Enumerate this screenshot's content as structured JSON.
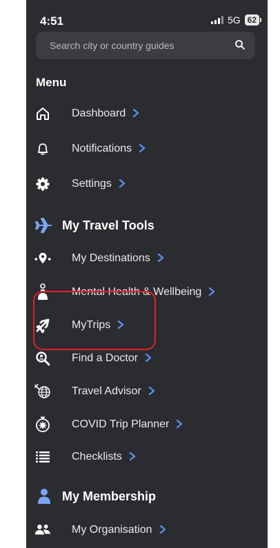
{
  "status": {
    "time": "4:51",
    "network": "5G",
    "battery": "62"
  },
  "search": {
    "placeholder": "Search city or country guides"
  },
  "menu": {
    "title": "Menu",
    "items": [
      {
        "label": "Dashboard",
        "icon": "home-icon"
      },
      {
        "label": "Notifications",
        "icon": "bell-icon"
      },
      {
        "label": "Settings",
        "icon": "gear-icon"
      }
    ]
  },
  "travel_tools": {
    "title": "My Travel Tools",
    "items": [
      {
        "label": "My Destinations",
        "icon": "map-pin-icon"
      },
      {
        "label": "Mental Health & Wellbeing",
        "icon": "meditation-icon"
      },
      {
        "label": "MyTrips",
        "icon": "airplane-icon"
      },
      {
        "label": "Find a Doctor",
        "icon": "doctor-search-icon"
      },
      {
        "label": "Travel Advisor",
        "icon": "globe-plane-icon"
      },
      {
        "label": "COVID Trip Planner",
        "icon": "virus-timer-icon"
      },
      {
        "label": "Checklists",
        "icon": "checklist-icon"
      }
    ]
  },
  "membership": {
    "title": "My Membership",
    "items": [
      {
        "label": "My Organisation",
        "icon": "group-icon"
      }
    ]
  },
  "colors": {
    "background": "#2b2c30",
    "accent": "#5b8ef0",
    "highlight": "#e5202a"
  }
}
